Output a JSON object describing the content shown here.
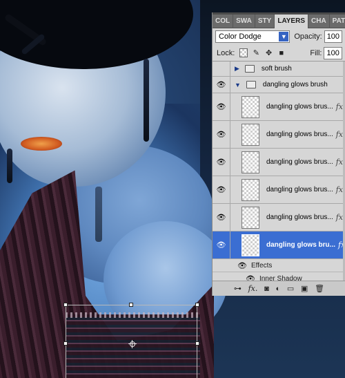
{
  "panel": {
    "tabs": [
      {
        "label": "COL"
      },
      {
        "label": "SWA"
      },
      {
        "label": "STY"
      },
      {
        "label": "LAYERS"
      },
      {
        "label": "CHA"
      },
      {
        "label": "PAT"
      }
    ],
    "blend_mode": "Color Dodge",
    "opacity_label": "Opacity:",
    "opacity_value": "100",
    "lock_label": "Lock:",
    "fill_label": "Fill:",
    "fill_value": "100"
  },
  "layers": [
    {
      "name": "soft brush",
      "type": "group",
      "collapsed": true
    },
    {
      "name": "dangling glows brush",
      "type": "group",
      "collapsed": false
    },
    {
      "name": "dangling glows brus...",
      "type": "layer",
      "fx": "fx"
    },
    {
      "name": "dangling glows brus...",
      "type": "layer",
      "fx": "fx"
    },
    {
      "name": "dangling glows brus...",
      "type": "layer",
      "fx": "fx"
    },
    {
      "name": "dangling glows brus...",
      "type": "layer",
      "fx": "fx"
    },
    {
      "name": "dangling glows brus...",
      "type": "layer",
      "fx": "fx"
    },
    {
      "name": "dangling glows bru...",
      "type": "layer",
      "fx": "fx",
      "selected": true
    }
  ],
  "effects": {
    "label": "Effects",
    "items": [
      "Inner Shadow"
    ]
  },
  "bottom_bar": {
    "fx_label": "fx."
  },
  "colors": {
    "selection": "#3b6ed2",
    "panel_bg": "#d6d6d6"
  },
  "icons": [
    "eye-icon",
    "folder-icon",
    "link-icon",
    "fx-icon",
    "mask-icon",
    "adjustment-icon",
    "new-group-icon",
    "new-layer-icon",
    "trash-icon",
    "lock-pixels-icon",
    "lock-brush-icon",
    "lock-move-icon",
    "lock-all-icon"
  ]
}
